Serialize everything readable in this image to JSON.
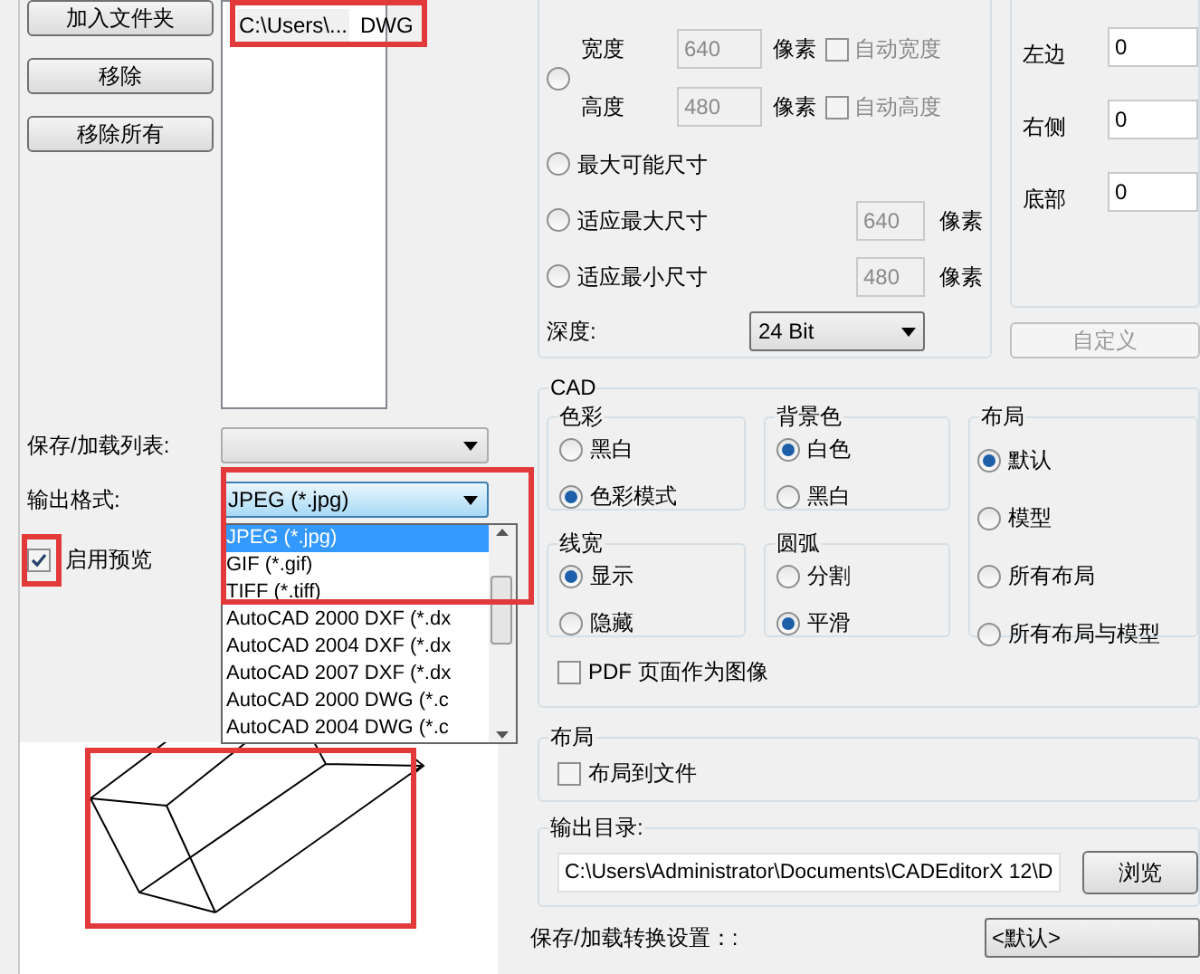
{
  "file_buttons": [
    {
      "label": "加入文件夹"
    },
    {
      "label": "移除"
    },
    {
      "label": "移除所有"
    }
  ],
  "file_list": {
    "rows": [
      {
        "path": "C:\\Users\\...",
        "type": "DWG"
      }
    ]
  },
  "save_load_list": {
    "label": "保存/加载列表:"
  },
  "output_format": {
    "label": "输出格式:",
    "value": "JPEG (*.jpg)",
    "options": [
      {
        "label": "JPEG (*.jpg)",
        "selected": true
      },
      {
        "label": "GIF (*.gif)",
        "selected": false
      },
      {
        "label": "TIFF (*.tiff)",
        "selected": false
      },
      {
        "label": "AutoCAD 2000 DXF (*.dx",
        "selected": false
      },
      {
        "label": "AutoCAD 2004 DXF (*.dx",
        "selected": false
      },
      {
        "label": "AutoCAD 2007 DXF (*.dx",
        "selected": false
      },
      {
        "label": "AutoCAD 2000 DWG (*.c",
        "selected": false
      },
      {
        "label": "AutoCAD 2004 DWG (*.c",
        "selected": false
      }
    ]
  },
  "preview": {
    "label": "启用预览",
    "checked": true
  },
  "size": {
    "custom": {
      "selected": false,
      "fields": [
        {
          "label": "宽度",
          "value": "640",
          "unit": "像素",
          "auto_label": "自动宽度",
          "auto_checked": false
        },
        {
          "label": "高度",
          "value": "480",
          "unit": "像素",
          "auto_label": "自动高度",
          "auto_checked": false
        }
      ]
    },
    "options": [
      {
        "kind": "plain",
        "label": "最大可能尺寸",
        "selected": false
      },
      {
        "kind": "limit",
        "label": "适应最大尺寸",
        "value": "640",
        "unit": "像素",
        "selected": false
      },
      {
        "kind": "limit",
        "label": "适应最小尺寸",
        "value": "480",
        "unit": "像素",
        "selected": false
      }
    ]
  },
  "depth": {
    "label": "深度:",
    "value": "24 Bit"
  },
  "margins": [
    {
      "label": "左边",
      "value": "0"
    },
    {
      "label": "右侧",
      "value": "0"
    },
    {
      "label": "底部",
      "value": "0"
    }
  ],
  "custom_button": {
    "label": "自定义",
    "disabled": true
  },
  "cad": {
    "title": "CAD",
    "groups": [
      {
        "title": "色彩",
        "options": [
          {
            "label": "黑白",
            "selected": false
          },
          {
            "label": "色彩模式",
            "selected": true
          }
        ]
      },
      {
        "title": "背景色",
        "options": [
          {
            "label": "白色",
            "selected": true
          },
          {
            "label": "黑白",
            "selected": false
          }
        ]
      },
      {
        "title": "线宽",
        "options": [
          {
            "label": "显示",
            "selected": true
          },
          {
            "label": "隐藏",
            "selected": false
          }
        ]
      },
      {
        "title": "圆弧",
        "options": [
          {
            "label": "分割",
            "selected": false
          },
          {
            "label": "平滑",
            "selected": true
          }
        ]
      }
    ],
    "layout": {
      "title": "布局",
      "options": [
        {
          "label": "默认",
          "selected": true
        },
        {
          "label": "模型",
          "selected": false
        },
        {
          "label": "所有布局",
          "selected": false
        },
        {
          "label": "所有布局与模型",
          "selected": false
        }
      ]
    },
    "pdf_as_image": {
      "label": "PDF 页面作为图像",
      "checked": false
    }
  },
  "layout_section": {
    "title": "布局",
    "to_file": {
      "label": "布局到文件",
      "checked": false
    }
  },
  "output_dir": {
    "title": "输出目录:",
    "value": "C:\\Users\\Administrator\\Documents\\CADEditorX 12\\D",
    "browse": "浏览"
  },
  "conversion_settings": {
    "label": "保存/加载转换设置：:",
    "value": "<默认>"
  }
}
